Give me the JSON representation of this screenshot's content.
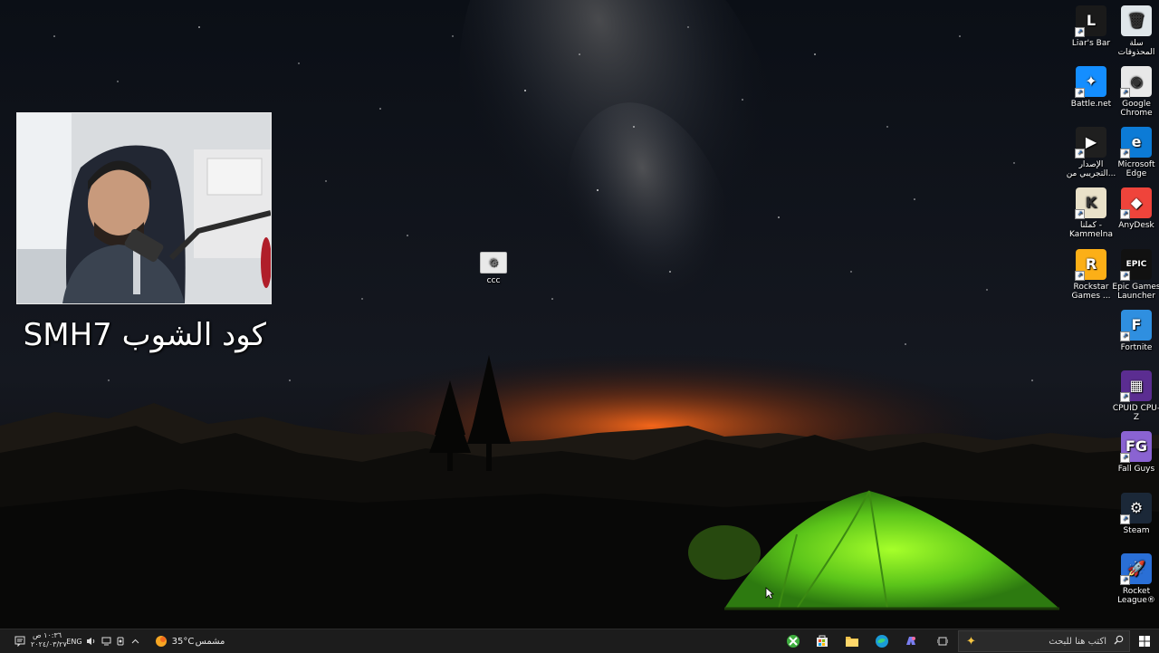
{
  "overlay": {
    "shop_code_text": "كود الشوب SMH7"
  },
  "desktop": {
    "center_icon": {
      "label": "ccc",
      "icon": "generic-file-icon"
    },
    "icons": [
      {
        "id": "liars-bar",
        "label": "Liar's Bar",
        "icon": "liars-bar-icon",
        "color": "#1a1a1a"
      },
      {
        "id": "recycle-bin",
        "label": "سلة المحذوفات",
        "icon": "recycle-bin-icon",
        "color": "#dfe6ea"
      },
      {
        "id": "battlenet",
        "label": "Battle.net",
        "icon": "battlenet-icon",
        "color": "#148eff"
      },
      {
        "id": "chrome",
        "label": "Google Chrome",
        "icon": "chrome-icon",
        "color": "#e8e8e8"
      },
      {
        "id": "play-games",
        "label": "الإصدار التجريبي من...",
        "icon": "google-play-games-icon",
        "color": "#1f1f1f"
      },
      {
        "id": "edge",
        "label": "Microsoft Edge",
        "icon": "edge-icon",
        "color": "#0c7bd6"
      },
      {
        "id": "kammelna",
        "label": "كملنا - Kammelna",
        "icon": "kammelna-icon",
        "color": "#e9e1c9"
      },
      {
        "id": "anydesk",
        "label": "AnyDesk",
        "icon": "anydesk-icon",
        "color": "#ef443b"
      },
      {
        "id": "rockstar",
        "label": "Rockstar Games ...",
        "icon": "rockstar-icon",
        "color": "#fcaf17"
      },
      {
        "id": "epic",
        "label": "Epic Games Launcher",
        "icon": "epic-games-icon",
        "color": "#111111"
      },
      {
        "id": "fortnite",
        "label": "Fortnite",
        "icon": "fortnite-icon",
        "color": "#2f8fe0"
      },
      {
        "id": "cpuz",
        "label": "CPUID CPU-Z",
        "icon": "cpuz-icon",
        "color": "#5b2d91"
      },
      {
        "id": "fallguys",
        "label": "Fall Guys",
        "icon": "fall-guys-icon",
        "color": "#8a63d2"
      },
      {
        "id": "steam",
        "label": "Steam",
        "icon": "steam-icon",
        "color": "#1b2838"
      },
      {
        "id": "rocketleague",
        "label": "Rocket League®",
        "icon": "rocket-league-icon",
        "color": "#2a6fd6"
      }
    ]
  },
  "taskbar": {
    "search_placeholder": "اكتب هنا للبحث",
    "weather_temp": "35°C",
    "weather_desc": "مشمس",
    "language": "ENG",
    "time": "١٠:٣٦ ص",
    "date": "٢٠٢٤/٠٣/٢٧",
    "pinned": [
      {
        "id": "xbox",
        "icon": "xbox-icon",
        "color": "#3fae3f"
      },
      {
        "id": "store",
        "icon": "microsoft-store-icon",
        "color": "#e8e8e8"
      },
      {
        "id": "explorer",
        "icon": "file-explorer-icon",
        "color": "#f4c24a"
      },
      {
        "id": "edge",
        "icon": "edge-icon",
        "color": "#1a9bd8"
      },
      {
        "id": "copilot",
        "icon": "copilot-icon",
        "color": "#7a7ef0"
      }
    ]
  }
}
